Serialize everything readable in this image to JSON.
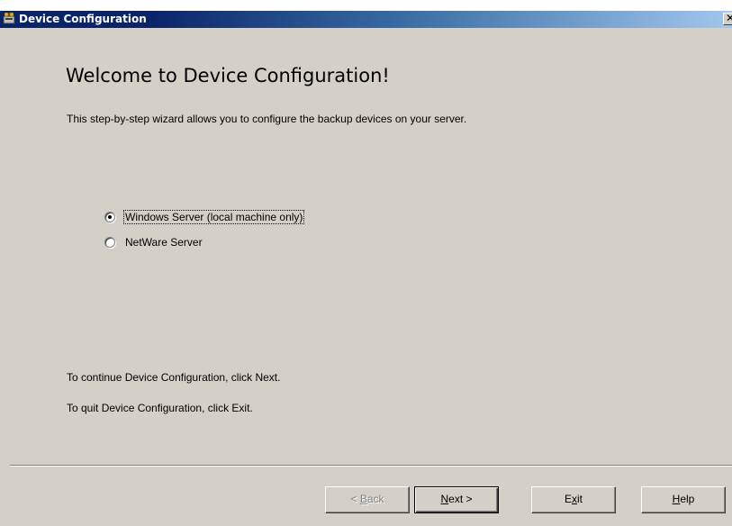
{
  "window": {
    "title": "Device Configuration",
    "close_glyph": "✕",
    "app_icon": "device-config-icon"
  },
  "wizard": {
    "heading": "Welcome to Device Configuration!",
    "description": "This step-by-step wizard allows you to configure the backup devices on your server.",
    "options": [
      {
        "label": "Windows Server (local machine only)",
        "selected": true
      },
      {
        "label": "NetWare Server",
        "selected": false
      }
    ],
    "continue_text": "To continue Device Configuration, click Next.",
    "quit_text": "To quit Device Configuration, click Exit."
  },
  "buttons": {
    "back": {
      "prefix": "< ",
      "accel": "B",
      "rest": "ack",
      "enabled": false
    },
    "next": {
      "accel": "N",
      "rest": "ext >",
      "enabled": true
    },
    "exit": {
      "pre": "E",
      "accel": "x",
      "rest": "it",
      "enabled": true
    },
    "help": {
      "accel": "H",
      "rest": "elp",
      "enabled": true
    }
  },
  "colors": {
    "titlebar": "#0a246a",
    "face": "#d4d0c8"
  }
}
